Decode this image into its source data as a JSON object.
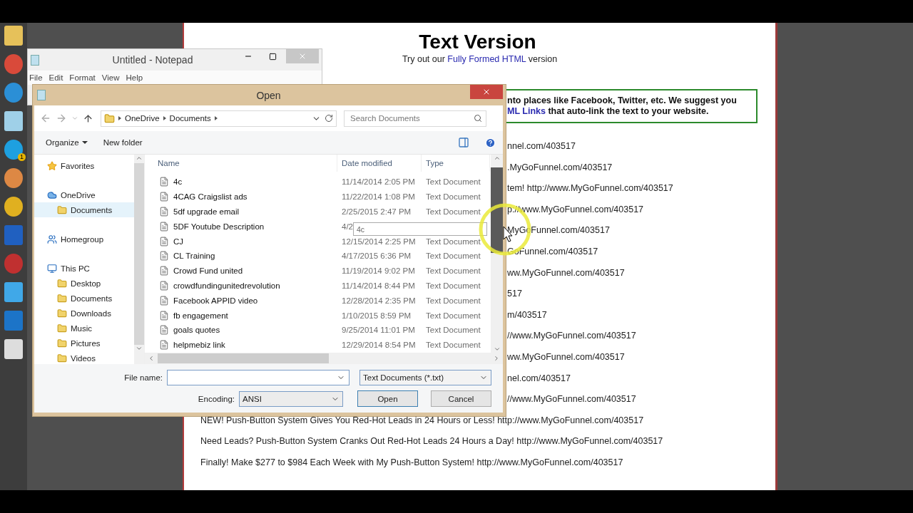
{
  "taskbar": {
    "badge": "1"
  },
  "notepad": {
    "title": "Untitled - Notepad",
    "menu": [
      "File",
      "Edit",
      "Format",
      "View",
      "Help"
    ]
  },
  "dialog": {
    "title": "Open",
    "address": [
      "OneDrive",
      "Documents"
    ],
    "search": {
      "placeholder": "Search Documents"
    },
    "toolbar": {
      "organize": "Organize",
      "new_folder": "New folder"
    },
    "nav": [
      {
        "label": "Favorites",
        "kind": "favorites",
        "selected": false
      },
      {
        "label": "OneDrive",
        "kind": "cloud",
        "selected": false,
        "children": [
          {
            "label": "Documents",
            "kind": "folder",
            "selected": true
          }
        ]
      },
      {
        "label": "Homegroup",
        "kind": "homegroup",
        "selected": false
      },
      {
        "label": "This PC",
        "kind": "pc",
        "selected": false,
        "children": [
          {
            "label": "Desktop",
            "kind": "folder",
            "selected": false
          },
          {
            "label": "Documents",
            "kind": "folder",
            "selected": false
          },
          {
            "label": "Downloads",
            "kind": "folder",
            "selected": false
          },
          {
            "label": "Music",
            "kind": "folder",
            "selected": false
          },
          {
            "label": "Pictures",
            "kind": "folder",
            "selected": false
          },
          {
            "label": "Videos",
            "kind": "folder",
            "selected": false
          }
        ]
      }
    ],
    "columns": [
      "Name",
      "Date modified",
      "Type"
    ],
    "files": [
      {
        "name": "4c",
        "date": "11/14/2014 2:05 PM",
        "type": "Text Document"
      },
      {
        "name": "4CAG Craigslist ads",
        "date": "11/22/2014 1:08 PM",
        "type": "Text Document"
      },
      {
        "name": "5df upgrade email",
        "date": "2/25/2015 2:47 PM",
        "type": "Text Document"
      },
      {
        "name": "5DF Youtube Description",
        "date": "4/2"
      },
      {
        "name": "CJ",
        "date": "12/15/2014 2:25 PM",
        "type": "Text Document"
      },
      {
        "name": "CL Training",
        "date": "4/17/2015 6:36 PM",
        "type": "Text Document"
      },
      {
        "name": "Crowd Fund united",
        "date": "11/19/2014 9:02 PM",
        "type": "Text Document"
      },
      {
        "name": "crowdfundingunitedrevolution",
        "date": "11/14/2014 8:44 PM",
        "type": "Text Document"
      },
      {
        "name": "Facebook APPID video",
        "date": "12/28/2014 2:35 PM",
        "type": "Text Document"
      },
      {
        "name": "fb engagement",
        "date": "1/10/2015 8:59 PM",
        "type": "Text Document"
      },
      {
        "name": "goals quotes",
        "date": "9/25/2014 11:01 PM",
        "type": "Text Document"
      },
      {
        "name": "helpmebiz link",
        "date": "12/29/2014 8:54 PM",
        "type": "Text Document"
      }
    ],
    "tooltip": "4c",
    "file_name_label": "File name:",
    "filter": "Text Documents (*.txt)",
    "encoding_label": "Encoding:",
    "encoding": "ANSI",
    "buttons": [
      "Open",
      "Cancel"
    ]
  },
  "webpage": {
    "title": "Text Version",
    "subtitle": {
      "before": "Try out our",
      "link": "Fully Formed HTML",
      "after": "version"
    },
    "notice": [
      {
        "before": "nto places like Facebook, Twitter, etc. We suggest you"
      },
      {
        "link": "ML Links",
        "after": "that auto-link the text to your website."
      }
    ],
    "fragments": [
      "nnel.com/403517",
      ".MyGoFunnel.com/403517",
      "tem! http://www.MyGoFunnel.com/403517",
      "p://www.MyGoFunnel.com/403517",
      "MyGoFunnel.com/403517",
      "GoFunnel.com/403517",
      "ww.MyGoFunnel.com/403517",
      "517",
      "m/403517",
      "//www.MyGoFunnel.com/403517",
      "ww.MyGoFunnel.com/403517",
      "nel.com/403517",
      "//www.MyGoFunnel.com/403517"
    ],
    "lines": [
      "NEW! Push-Button System Gives You Red-Hot Leads in 24 Hours or Less! http://www.MyGoFunnel.com/403517",
      "Need Leads? Push-Button System Cranks Out Red-Hot Leads 24 Hours a Day! http://www.MyGoFunnel.com/403517",
      "Finally! Make $277 to $984 Each Week with My Push-Button System! http://www.MyGoFunnel.com/403517"
    ]
  }
}
